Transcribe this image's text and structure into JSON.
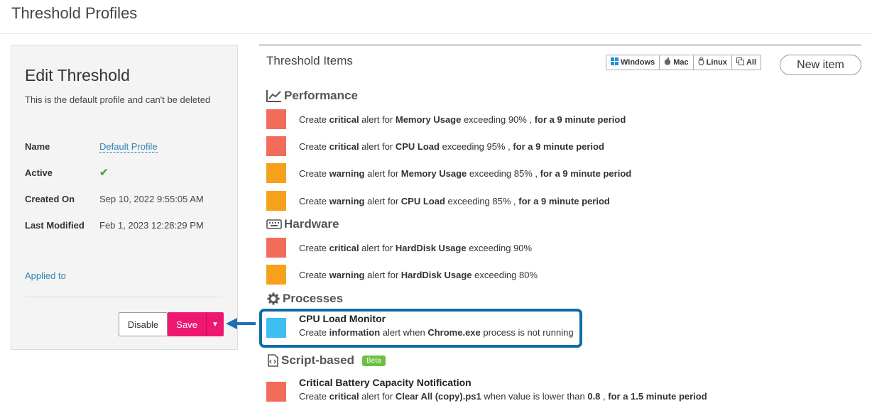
{
  "page": {
    "title": "Threshold Profiles"
  },
  "edit": {
    "title": "Edit Threshold",
    "subtitle": "This is the default profile and can't be deleted",
    "fields": {
      "name_label": "Name",
      "name_value": "Default Profile",
      "active_label": "Active",
      "active_value": "✔",
      "created_label": "Created On",
      "created_value": "Sep 10, 2022 9:55:05 AM",
      "modified_label": "Last Modified",
      "modified_value": "Feb 1, 2023 12:28:29 PM"
    },
    "applied_to": "Applied to",
    "buttons": {
      "disable": "Disable",
      "save": "Save",
      "caret": "▼"
    }
  },
  "items": {
    "title": "Threshold Items",
    "os_filter": [
      {
        "label": "Windows",
        "icon": "windows-icon"
      },
      {
        "label": "Mac",
        "icon": "apple-icon"
      },
      {
        "label": "Linux",
        "icon": "linux-icon"
      },
      {
        "label": "All",
        "icon": "copy-icon"
      }
    ],
    "new_item": "New item",
    "colors": {
      "critical": "#f26b5b",
      "warning": "#f5a11c",
      "information": "#3dbdf0"
    },
    "sections": {
      "performance": {
        "name": "Performance",
        "rows": [
          {
            "pre": "Create ",
            "level": "critical",
            "mid": " alert for ",
            "metric": "Memory Usage",
            "rest": " exceeding 90% , ",
            "period": "for a 9 minute period"
          },
          {
            "pre": "Create ",
            "level": "critical",
            "mid": " alert for ",
            "metric": "CPU Load",
            "rest": " exceeding 95% , ",
            "period": "for a 9 minute period"
          },
          {
            "pre": "Create ",
            "level": "warning",
            "mid": " alert for ",
            "metric": "Memory Usage",
            "rest": " exceeding 85% , ",
            "period": "for a 9 minute period"
          },
          {
            "pre": "Create ",
            "level": "warning",
            "mid": " alert for ",
            "metric": "CPU Load",
            "rest": " exceeding 85% , ",
            "period": "for a 9 minute period"
          }
        ]
      },
      "hardware": {
        "name": "Hardware",
        "rows": [
          {
            "pre": "Create ",
            "level": "critical",
            "mid": " alert for ",
            "metric": "HardDisk Usage",
            "rest": " exceeding 90%"
          },
          {
            "pre": "Create ",
            "level": "warning",
            "mid": " alert for ",
            "metric": "HardDisk Usage",
            "rest": " exceeding 80%"
          }
        ]
      },
      "processes": {
        "name": "Processes",
        "row": {
          "title": "CPU Load Monitor",
          "pre": "Create ",
          "level": "information",
          "mid": " alert when ",
          "process": "Chrome.exe",
          "rest": " process is not running"
        }
      },
      "script": {
        "name": "Script-based",
        "badge": "Beta",
        "row": {
          "title": "Critical Battery Capacity Notification",
          "pre": "Create ",
          "level": "critical",
          "mid": " alert for ",
          "script": "Clear All (copy).ps1",
          "rest": " when value is lower than ",
          "value": "0.8",
          "sep": " , ",
          "period": "for a 1.5 minute period"
        }
      }
    }
  }
}
